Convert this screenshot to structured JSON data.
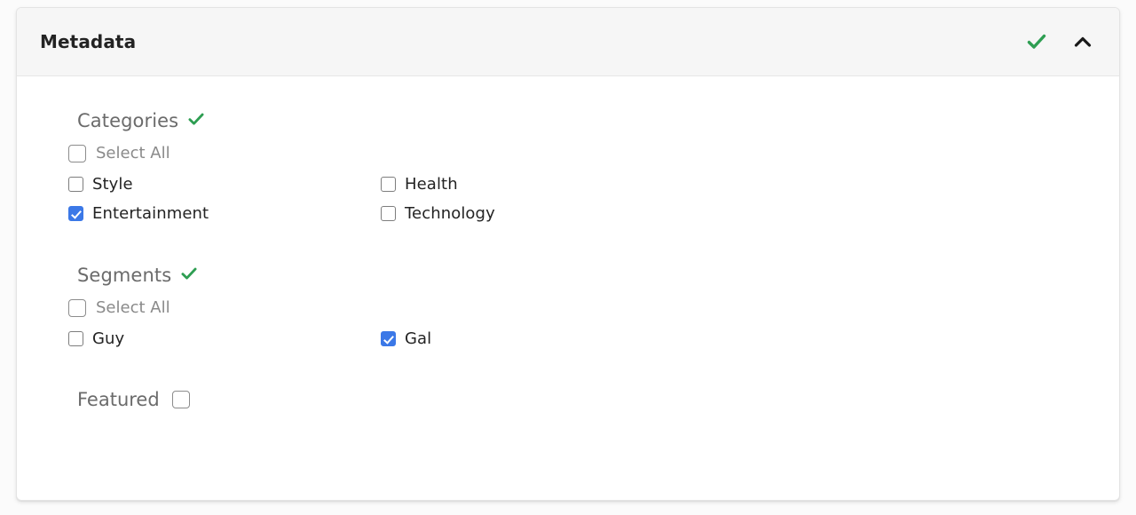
{
  "card": {
    "title": "Metadata",
    "header_icons": [
      {
        "name": "check-icon",
        "glyph": "check",
        "color": "#2e9e52"
      },
      {
        "name": "chevron-up-icon",
        "glyph": "chevron-up",
        "color": "#1a1a1a"
      }
    ]
  },
  "sections": [
    {
      "title": "Categories",
      "status_icon": "check-icon",
      "status_color": "#2e9e52",
      "select_all": {
        "label": "Select All",
        "checked": false
      },
      "options": [
        {
          "label": "Style",
          "checked": false
        },
        {
          "label": "Health",
          "checked": false
        },
        {
          "label": "Entertainment",
          "checked": true
        },
        {
          "label": "Technology",
          "checked": false
        }
      ]
    },
    {
      "title": "Segments",
      "status_icon": "check-icon",
      "status_color": "#2e9e52",
      "select_all": {
        "label": "Select All",
        "checked": false
      },
      "options": [
        {
          "label": "Guy",
          "checked": false
        },
        {
          "label": "Gal",
          "checked": true
        }
      ]
    }
  ],
  "featured": {
    "label": "Featured",
    "checked": false
  },
  "colors": {
    "accent_checked": "#3b78e7",
    "status_green": "#2e9e52",
    "title_text": "#232323",
    "muted_text": "#6b6b6b",
    "card_header_bg": "#f6f6f6",
    "page_bg": "#fbfbfb"
  }
}
